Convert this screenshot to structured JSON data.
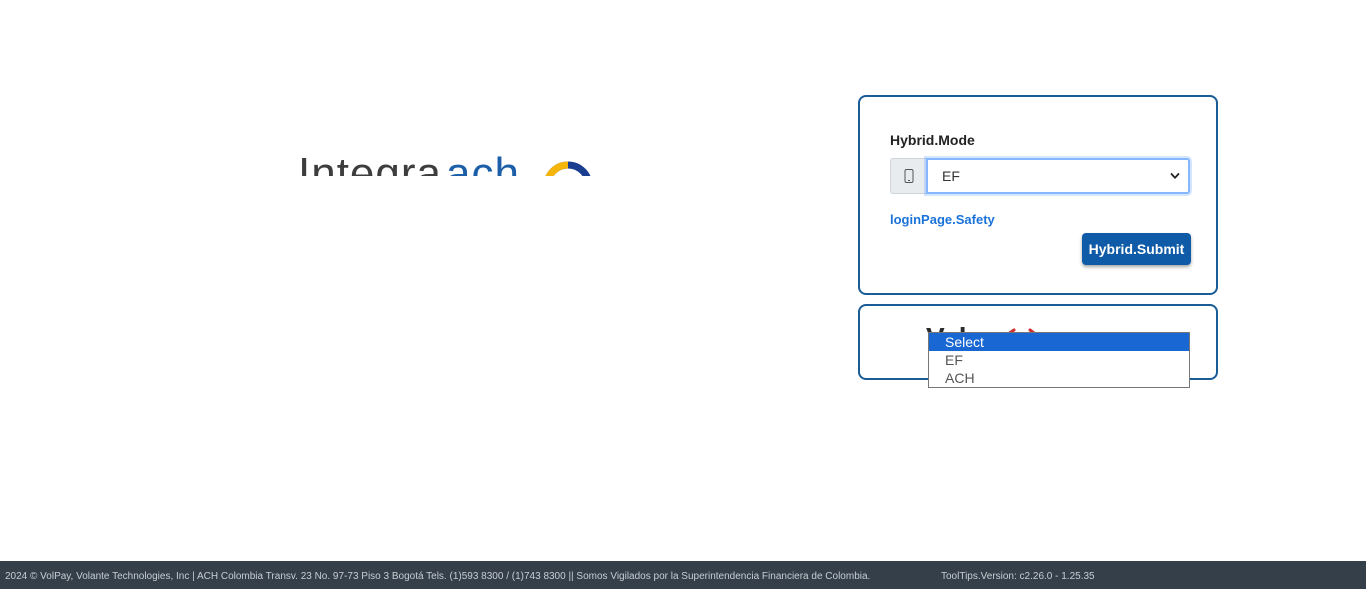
{
  "logo": {
    "part1": "Integra",
    "part2": "ach",
    "colors": {
      "primary": "#3d3d3d",
      "accent": "#1c5fa8",
      "ring_yellow": "#f5b50a",
      "ring_blue": "#1a3d8f"
    }
  },
  "login_card": {
    "mode_label": "Hybrid.Mode",
    "addon_icon": "mobile-icon",
    "select_value": "EF",
    "safety_link": "loginPage.Safety",
    "submit_label": "Hybrid.Submit"
  },
  "second_card": {
    "logo_text": "Volpay",
    "logo_icon": "volpay-logo-icon"
  },
  "dropdown": {
    "options": [
      "Select",
      "EF",
      "ACH"
    ],
    "highlighted": "Select"
  },
  "footer": {
    "copyright": "2024 © VolPay, Volante Technologies, Inc | ACH Colombia Transv. 23 No. 97-73 Piso 3 Bogotá Tels. (1)593 8300 / (1)743 8300 || Somos Vigilados por la Superintendencia Financiera de Colombia.",
    "version": "ToolTips.Version: c2.26.0 - 1.25.35"
  },
  "colors": {
    "card_border": "#1a5c96",
    "button": "#0f5ba7",
    "link": "#1a73d9",
    "footer_bg": "#343f4a",
    "selected_option": "#1967d2"
  }
}
